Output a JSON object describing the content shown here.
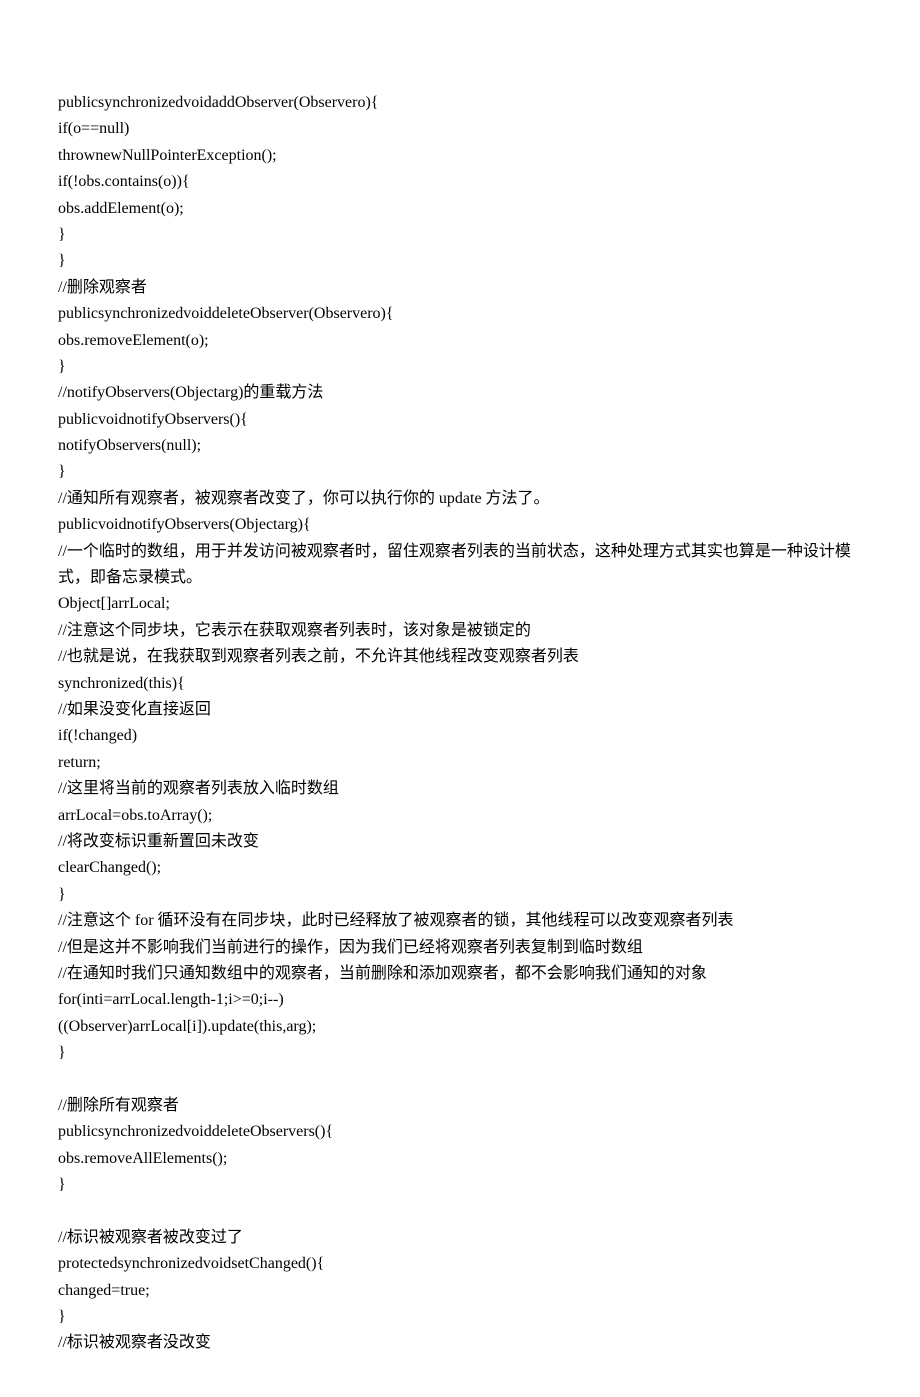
{
  "lines": [
    "publicsynchronizedvoidaddObserver(Observero){",
    "if(o==null)",
    "thrownewNullPointerException();",
    "if(!obs.contains(o)){",
    "obs.addElement(o);",
    "}",
    "}",
    "//删除观察者",
    "publicsynchronizedvoiddeleteObserver(Observero){",
    "obs.removeElement(o);",
    "}",
    "//notifyObservers(Objectarg)的重载方法",
    "publicvoidnotifyObservers(){",
    "notifyObservers(null);",
    "}",
    "//通知所有观察者，被观察者改变了，你可以执行你的 update 方法了。",
    "publicvoidnotifyObservers(Objectarg){",
    "//一个临时的数组，用于并发访问被观察者时，留住观察者列表的当前状态，这种处理方式其实也算是一种设计模式，即备忘录模式。",
    "Object[]arrLocal;",
    "//注意这个同步块，它表示在获取观察者列表时，该对象是被锁定的",
    "//也就是说，在我获取到观察者列表之前，不允许其他线程改变观察者列表",
    "synchronized(this){",
    "//如果没变化直接返回",
    "if(!changed)",
    "return;",
    "//这里将当前的观察者列表放入临时数组",
    "arrLocal=obs.toArray();",
    "//将改变标识重新置回未改变",
    "clearChanged();",
    "}",
    "//注意这个 for 循环没有在同步块，此时已经释放了被观察者的锁，其他线程可以改变观察者列表",
    "//但是这并不影响我们当前进行的操作，因为我们已经将观察者列表复制到临时数组",
    "//在通知时我们只通知数组中的观察者，当前删除和添加观察者，都不会影响我们通知的对象",
    "for(inti=arrLocal.length-1;i>=0;i--)",
    "((Observer)arrLocal[i]).update(this,arg);",
    "}",
    "",
    "//删除所有观察者",
    "publicsynchronizedvoiddeleteObservers(){",
    "obs.removeAllElements();",
    "}",
    "",
    "//标识被观察者被改变过了",
    "protectedsynchronizedvoidsetChanged(){",
    "changed=true;",
    "}",
    "//标识被观察者没改变"
  ]
}
